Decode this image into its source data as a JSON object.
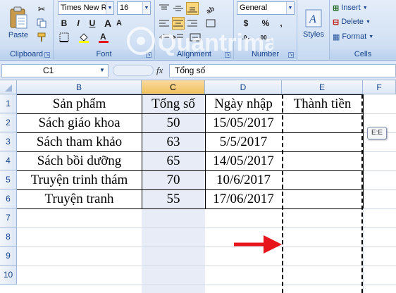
{
  "ribbon": {
    "clipboard": {
      "paste_label": "Paste",
      "group_label": "Clipboard"
    },
    "font": {
      "font_name": "Times New Ro",
      "font_size": "16",
      "group_label": "Font",
      "bold": "B",
      "italic": "I",
      "underline": "U",
      "grow": "A",
      "shrink": "A"
    },
    "alignment": {
      "group_label": "Alignment"
    },
    "number": {
      "format": "General",
      "currency": "$",
      "percent": "%",
      "comma": ",",
      "group_label": "Number"
    },
    "styles": {
      "label": "Styles"
    },
    "cells": {
      "insert": "Insert",
      "delete": "Delete",
      "format": "Format",
      "group_label": "Cells"
    }
  },
  "formula_bar": {
    "name_box": "C1",
    "fx": "fx",
    "content": "Tổng số"
  },
  "grid": {
    "columns": [
      "B",
      "C",
      "D",
      "E",
      "F"
    ],
    "rows": [
      "1",
      "2",
      "3",
      "4",
      "5",
      "6",
      "7",
      "8",
      "9",
      "10"
    ],
    "table": {
      "headers": [
        "Sản phẩm",
        "Tổng số",
        "Ngày nhập",
        "Thành tiền"
      ],
      "rows": [
        [
          "Sách giáo khoa",
          "50",
          "15/05/2017",
          ""
        ],
        [
          "Sách tham khảo",
          "63",
          "5/5/2017",
          ""
        ],
        [
          "Sách bồi dưỡng",
          "65",
          "14/05/2017",
          ""
        ],
        [
          "Truyện trinh thám",
          "70",
          "10/6/2017",
          ""
        ],
        [
          "Truyện tranh",
          "55",
          "17/06/2017",
          ""
        ]
      ]
    },
    "tooltip": "E:E"
  },
  "colors": {
    "arrow": "#e8141c",
    "selected_column": "#e8ecf6",
    "header_selected": "#f1c15f"
  }
}
